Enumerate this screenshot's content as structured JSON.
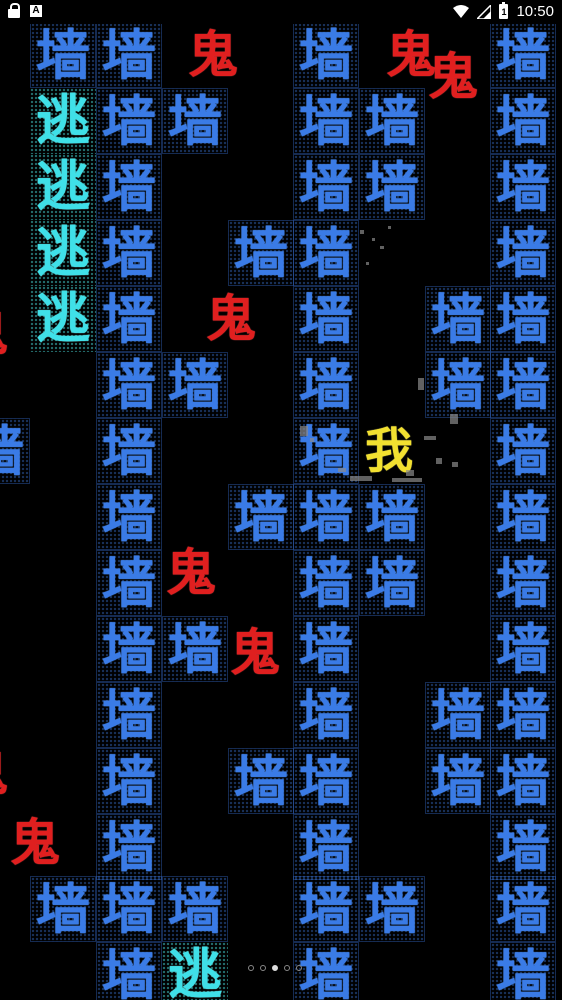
{
  "status_bar": {
    "time": "10:50",
    "battery_level": "1",
    "icons": [
      "lock-icon",
      "a-icon",
      "wifi-icon",
      "signal-icon",
      "battery-icon"
    ]
  },
  "glyphs": {
    "wall": "墙",
    "ghost": "鬼",
    "player": "我",
    "escape": "逃"
  },
  "colors": {
    "background": "#000000",
    "wall": "#3a7be6",
    "escape": "#3fe0e8",
    "ghost": "#e01f1f",
    "player": "#f2e030"
  },
  "pager": {
    "count": 5,
    "active_index": 2
  }
}
